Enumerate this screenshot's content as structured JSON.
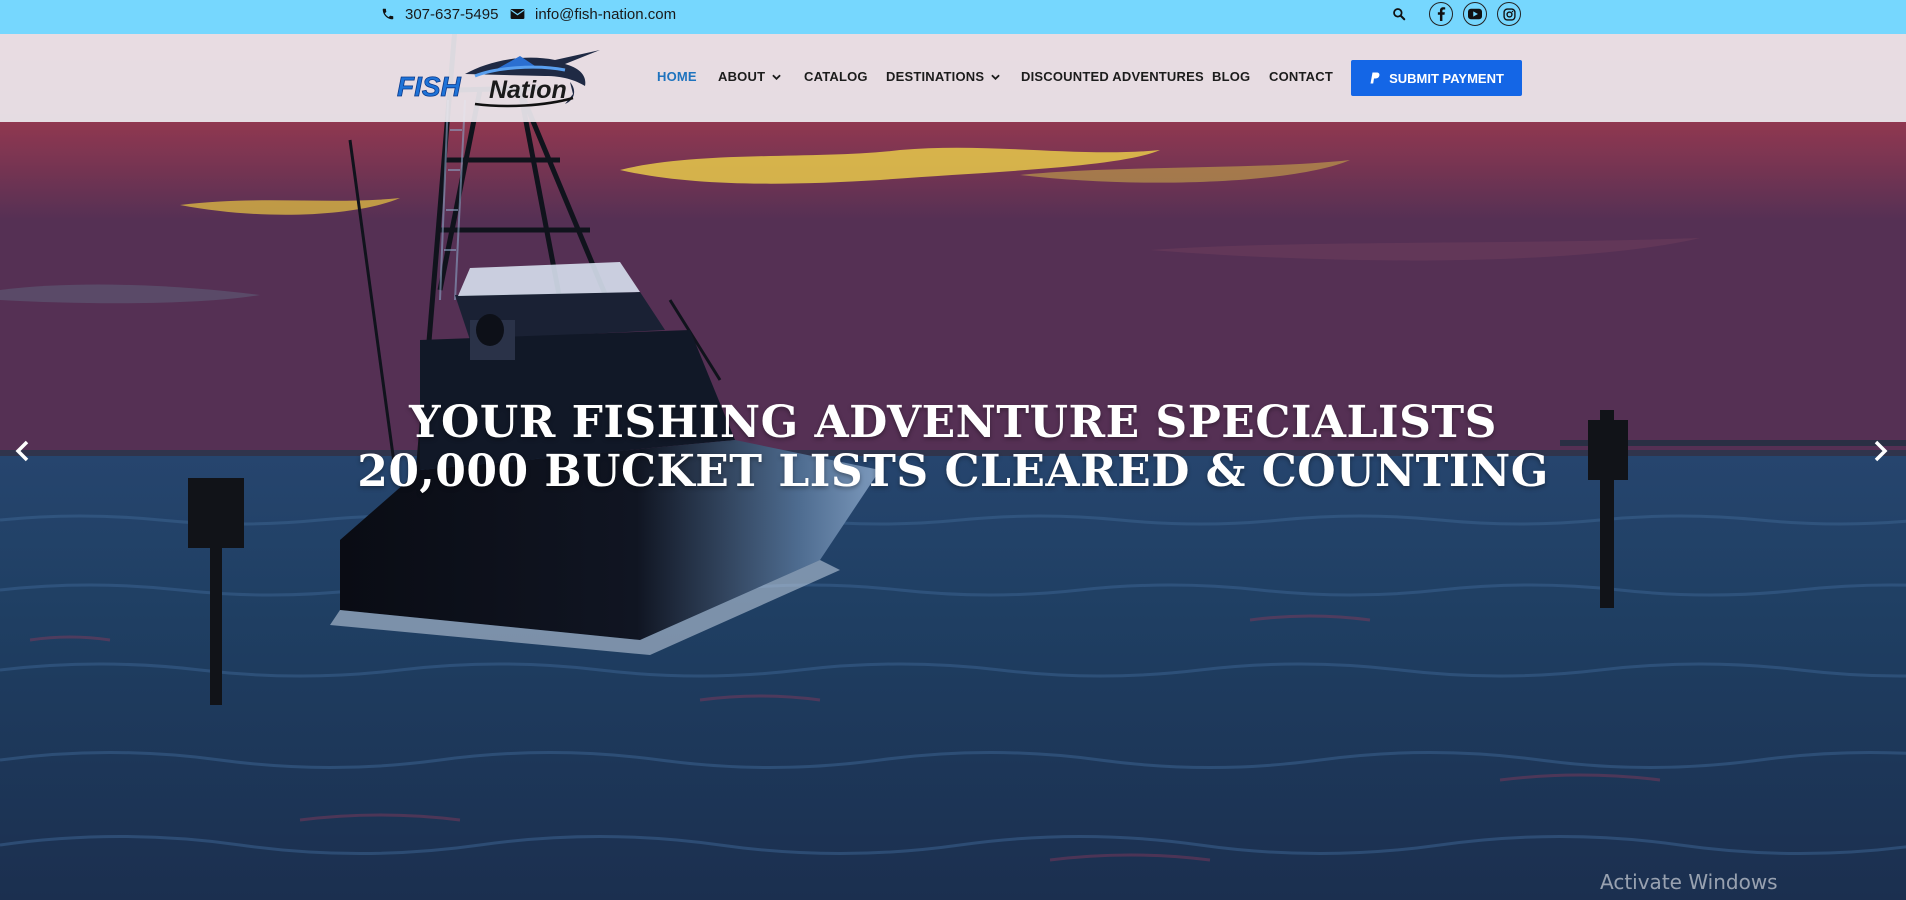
{
  "topbar": {
    "phone": "307-637-5495",
    "email": "info@fish-nation.com",
    "search_icon": "search-icon",
    "social": [
      "facebook-icon",
      "youtube-icon",
      "instagram-icon"
    ],
    "background": "#76d7fe"
  },
  "header": {
    "logo_text_left": "FISH",
    "logo_text_right": "Nation",
    "nav": [
      {
        "label": "HOME",
        "active": true
      },
      {
        "label": "ABOUT",
        "dropdown": true
      },
      {
        "label": "CATALOG"
      },
      {
        "label": "DESTINATIONS",
        "dropdown": true
      },
      {
        "label": "DISCOUNTED ADVENTURES"
      },
      {
        "label": "BLOG"
      },
      {
        "label": "CONTACT"
      }
    ],
    "cta_label": "SUBMIT PAYMENT",
    "cta_icon": "paypal-icon",
    "accent": "#1e73be",
    "cta_color": "#1466e6"
  },
  "hero": {
    "headline_line1": "YOUR FISHING ADVENTURE SPECIALISTS",
    "headline_line2": "20,000 BUCKET LISTS CLEARED & COUNTING",
    "prev_icon": "chevron-left-icon",
    "next_icon": "chevron-right-icon"
  },
  "os_overlay": {
    "watermark": "Activate Windows"
  }
}
